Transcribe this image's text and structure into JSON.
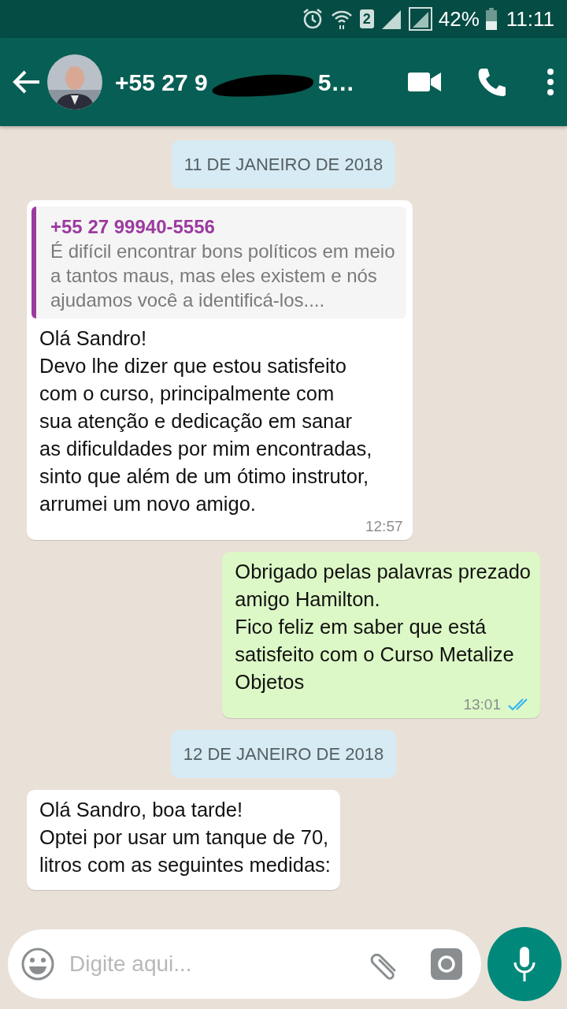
{
  "status_bar": {
    "sim": "2",
    "battery_text": "42%",
    "time": "11:11"
  },
  "header": {
    "title_start": "+55 27 9",
    "title_end": "5…",
    "redacted": true
  },
  "messages": [
    {
      "kind": "date",
      "text": "11 DE JANEIRO DE 2018"
    },
    {
      "kind": "incoming",
      "quote": {
        "author": "+55 27 99940-5556",
        "text": "É difícil encontrar bons políticos em meio\na tantos maus, mas eles existem e nós\najudamos você a identificá-los...."
      },
      "text": "Olá Sandro!\nDevo lhe dizer que estou satisfeito\ncom o curso, principalmente com\nsua atenção e dedicação em sanar\nas dificuldades por mim encontradas,\nsinto que além de um ótimo instrutor,\narrumei um novo amigo.",
      "time": "12:57"
    },
    {
      "kind": "outgoing",
      "text": "Obrigado pelas palavras prezado\namigo Hamilton.\nFico feliz em saber que está\nsatisfeito com o Curso Metalize\nObjetos",
      "time": "13:01",
      "read": true
    },
    {
      "kind": "date",
      "text": "12 DE JANEIRO DE 2018"
    },
    {
      "kind": "incoming",
      "text": "Olá Sandro, boa tarde!\nOptei por usar um tanque de 70,\nlitros com as seguintes medidas:"
    }
  ],
  "composer": {
    "placeholder": "Digite aqui..."
  }
}
